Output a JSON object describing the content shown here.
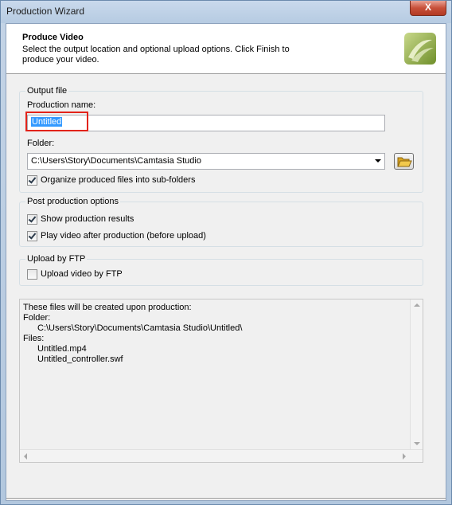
{
  "window": {
    "title": "Production Wizard",
    "close_label": "X"
  },
  "header": {
    "title": "Produce Video",
    "description": "Select the output location and optional upload options. Click Finish to produce your video."
  },
  "output_file": {
    "legend": "Output file",
    "production_name_label": "Production name:",
    "production_name_value": "Untitled",
    "folder_label": "Folder:",
    "folder_value": "C:\\Users\\Story\\Documents\\Camtasia Studio",
    "organize_label": "Organize produced files into sub-folders",
    "organize_checked": true
  },
  "post_production": {
    "legend": "Post production options",
    "show_results_label": "Show production results",
    "show_results_checked": true,
    "play_video_label": "Play video after production (before upload)",
    "play_video_checked": true
  },
  "ftp": {
    "legend": "Upload by FTP",
    "upload_label": "Upload video by FTP",
    "upload_checked": false
  },
  "info": {
    "line1": "These files will be created upon production:",
    "folder_heading": "Folder:",
    "folder_path": "C:\\Users\\Story\\Documents\\Camtasia Studio\\Untitled\\",
    "files_heading": "Files:",
    "files": [
      "Untitled.mp4",
      "Untitled_controller.swf"
    ]
  },
  "icons": {
    "close": "close-icon",
    "logo": "camtasia-logo-icon",
    "folder": "folder-open-icon",
    "check": "checkmark-icon"
  }
}
